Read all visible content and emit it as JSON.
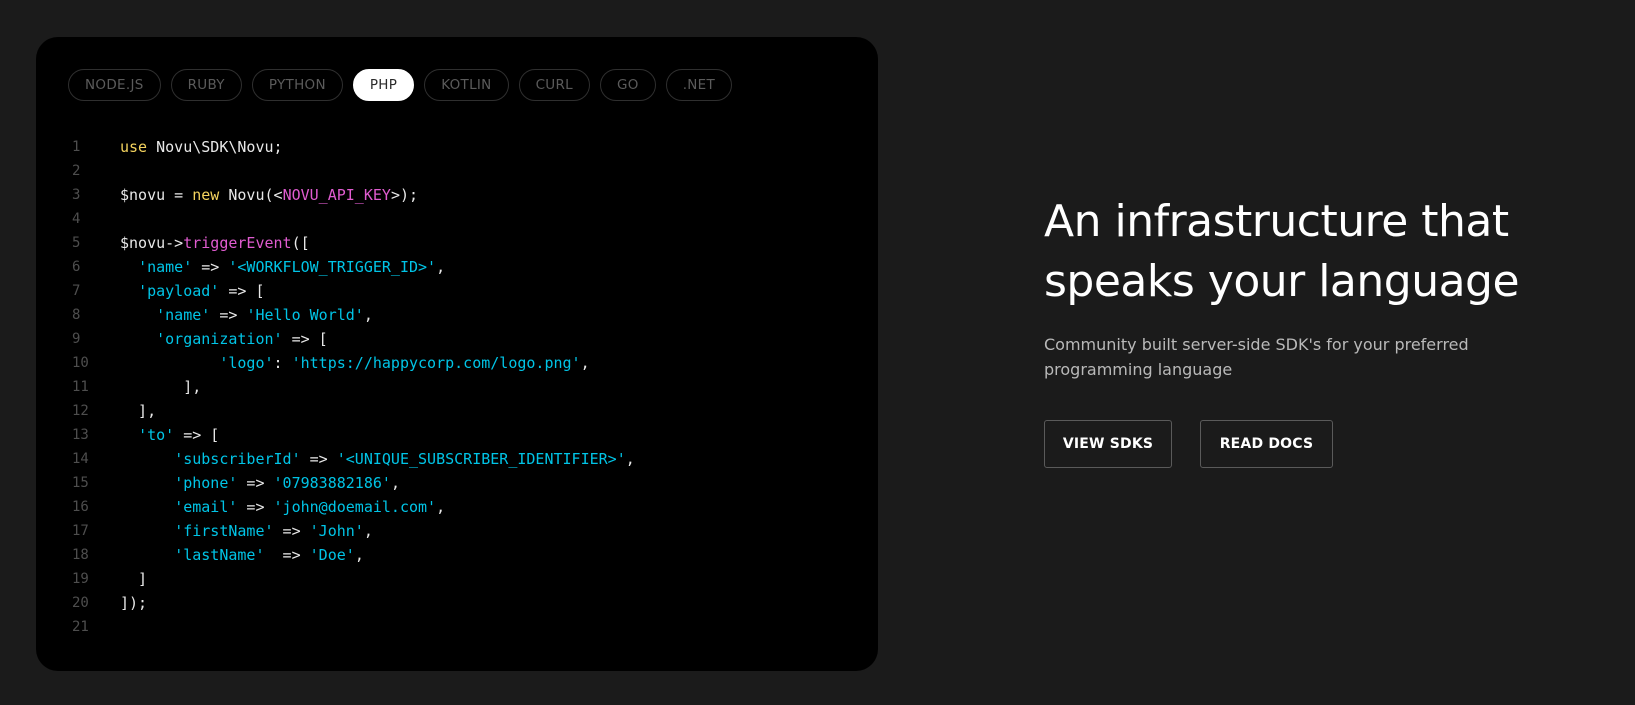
{
  "tabs": [
    {
      "label": "NODE.JS",
      "active": false
    },
    {
      "label": "RUBY",
      "active": false
    },
    {
      "label": "PYTHON",
      "active": false
    },
    {
      "label": "PHP",
      "active": true
    },
    {
      "label": "KOTLIN",
      "active": false
    },
    {
      "label": "CURL",
      "active": false
    },
    {
      "label": "GO",
      "active": false
    },
    {
      "label": ".NET",
      "active": false
    }
  ],
  "code": {
    "language": "PHP",
    "colors": {
      "keyword": "#f4d35e",
      "string": "#00c4e6",
      "function": "#e05cd0",
      "plain": "#e8e8e8",
      "line_number": "#4e4e4e"
    },
    "lines": [
      [
        {
          "t": "kw",
          "v": "use"
        },
        {
          "t": "plain",
          "v": " Novu\\SDK\\Novu;"
        }
      ],
      [],
      [
        {
          "t": "var",
          "v": "$novu"
        },
        {
          "t": "plain",
          "v": " = "
        },
        {
          "t": "kw",
          "v": "new"
        },
        {
          "t": "plain",
          "v": " Novu(<"
        },
        {
          "t": "fn",
          "v": "NOVU_API_KEY"
        },
        {
          "t": "plain",
          "v": ">);"
        }
      ],
      [],
      [
        {
          "t": "var",
          "v": "$novu"
        },
        {
          "t": "plain",
          "v": "->"
        },
        {
          "t": "fn",
          "v": "triggerEvent"
        },
        {
          "t": "plain",
          "v": "(["
        }
      ],
      [
        {
          "t": "plain",
          "v": "  "
        },
        {
          "t": "str",
          "v": "'name'"
        },
        {
          "t": "plain",
          "v": " => "
        },
        {
          "t": "str",
          "v": "'<WORKFLOW_TRIGGER_ID>'"
        },
        {
          "t": "plain",
          "v": ","
        }
      ],
      [
        {
          "t": "plain",
          "v": "  "
        },
        {
          "t": "str",
          "v": "'payload'"
        },
        {
          "t": "plain",
          "v": " => ["
        }
      ],
      [
        {
          "t": "plain",
          "v": "    "
        },
        {
          "t": "str",
          "v": "'name'"
        },
        {
          "t": "plain",
          "v": " => "
        },
        {
          "t": "str",
          "v": "'Hello World'"
        },
        {
          "t": "plain",
          "v": ","
        }
      ],
      [
        {
          "t": "plain",
          "v": "    "
        },
        {
          "t": "str",
          "v": "'organization'"
        },
        {
          "t": "plain",
          "v": " => ["
        }
      ],
      [
        {
          "t": "plain",
          "v": "           "
        },
        {
          "t": "str",
          "v": "'logo'"
        },
        {
          "t": "plain",
          "v": ": "
        },
        {
          "t": "str",
          "v": "'https://happycorp.com/logo.png'"
        },
        {
          "t": "plain",
          "v": ","
        }
      ],
      [
        {
          "t": "plain",
          "v": "       ],"
        }
      ],
      [
        {
          "t": "plain",
          "v": "  ],"
        }
      ],
      [
        {
          "t": "plain",
          "v": "  "
        },
        {
          "t": "str",
          "v": "'to'"
        },
        {
          "t": "plain",
          "v": " => ["
        }
      ],
      [
        {
          "t": "plain",
          "v": "      "
        },
        {
          "t": "str",
          "v": "'subscriberId'"
        },
        {
          "t": "plain",
          "v": " => "
        },
        {
          "t": "str",
          "v": "'<UNIQUE_SUBSCRIBER_IDENTIFIER>'"
        },
        {
          "t": "plain",
          "v": ","
        }
      ],
      [
        {
          "t": "plain",
          "v": "      "
        },
        {
          "t": "str",
          "v": "'phone'"
        },
        {
          "t": "plain",
          "v": " => "
        },
        {
          "t": "str",
          "v": "'07983882186'"
        },
        {
          "t": "plain",
          "v": ","
        }
      ],
      [
        {
          "t": "plain",
          "v": "      "
        },
        {
          "t": "str",
          "v": "'email'"
        },
        {
          "t": "plain",
          "v": " => "
        },
        {
          "t": "str",
          "v": "'john@doemail.com'"
        },
        {
          "t": "plain",
          "v": ","
        }
      ],
      [
        {
          "t": "plain",
          "v": "      "
        },
        {
          "t": "str",
          "v": "'firstName'"
        },
        {
          "t": "plain",
          "v": " => "
        },
        {
          "t": "str",
          "v": "'John'"
        },
        {
          "t": "plain",
          "v": ","
        }
      ],
      [
        {
          "t": "plain",
          "v": "      "
        },
        {
          "t": "str",
          "v": "'lastName'"
        },
        {
          "t": "plain",
          "v": "  => "
        },
        {
          "t": "str",
          "v": "'Doe'"
        },
        {
          "t": "plain",
          "v": ","
        }
      ],
      [
        {
          "t": "plain",
          "v": "  ]"
        }
      ],
      [
        {
          "t": "plain",
          "v": "]);"
        }
      ],
      []
    ]
  },
  "hero": {
    "title": "An infrastructure that speaks your language",
    "subtitle": "Community built server-side SDK's for your preferred programming language",
    "primary_button": "VIEW SDKS",
    "secondary_button": "READ DOCS"
  },
  "colors": {
    "page_background": "#1b1b1b",
    "card_background": "#000000",
    "active_tab": "#ffffff"
  }
}
